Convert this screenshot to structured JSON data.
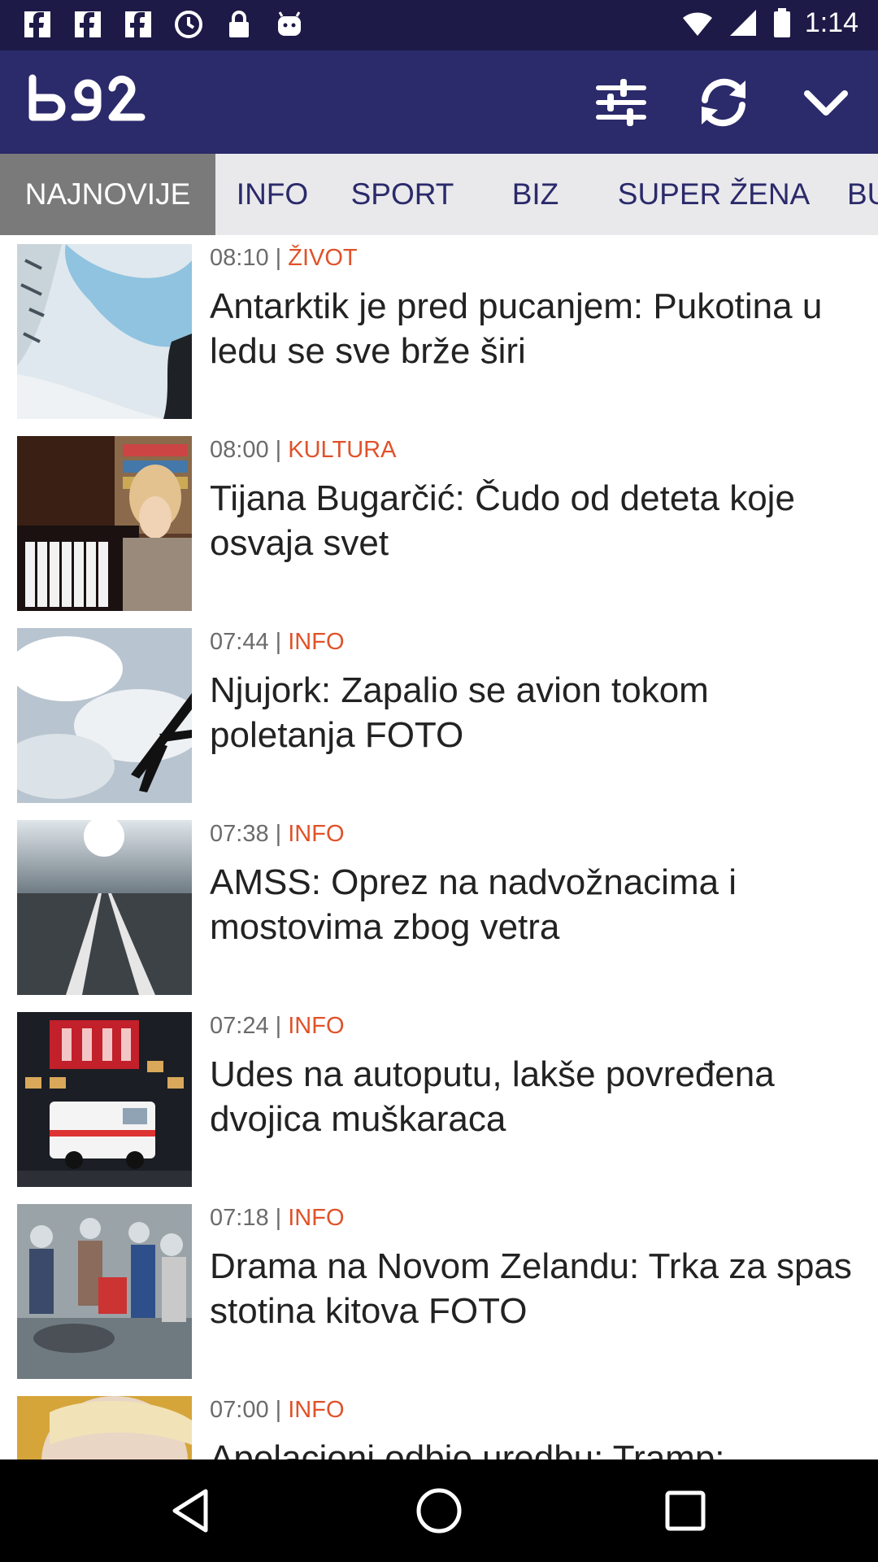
{
  "status_bar": {
    "time": "1:14",
    "icons": [
      "facebook-icon",
      "facebook-icon",
      "facebook-icon",
      "sync-icon",
      "lock-icon",
      "android-icon",
      "wifi-icon",
      "signal-icon",
      "battery-icon"
    ]
  },
  "header": {
    "logo": "b92",
    "buttons": [
      "filter-sliders-icon",
      "refresh-icon",
      "chevron-down-icon"
    ]
  },
  "tabs": [
    {
      "label": "NAJNOVIJE",
      "active": true
    },
    {
      "label": "INFO"
    },
    {
      "label": "SPORT"
    },
    {
      "label": "BIZ"
    },
    {
      "label": "SUPER ŽENA"
    },
    {
      "label": "BU"
    }
  ],
  "news": [
    {
      "time": "08:10",
      "separator": " | ",
      "category": "ŽIVOT",
      "title": "Antarktik je pred pucanjem: Pukotina u ledu se sve brže širi"
    },
    {
      "time": "08:00",
      "separator": " | ",
      "category": "KULTURA",
      "title": "Tijana Bugarčić: Čudo od deteta koje osvaja svet"
    },
    {
      "time": "07:44",
      "separator": " | ",
      "category": "INFO",
      "title": "Njujork: Zapalio se avion tokom poletanja FOTO"
    },
    {
      "time": "07:38",
      "separator": " | ",
      "category": "INFO",
      "title": "AMSS: Oprez na nadvožnacima i mostovima zbog vetra"
    },
    {
      "time": "07:24",
      "separator": " | ",
      "category": "INFO",
      "title": "Udes na autoputu, lakše povređena dvojica muškaraca"
    },
    {
      "time": "07:18",
      "separator": " | ",
      "category": "INFO",
      "title": "Drama na Novom Zelandu: Trka za spas stotina kitova FOTO"
    },
    {
      "time": "07:00",
      "separator": " | ",
      "category": "INFO",
      "title": "Apelacioni odbio uredbu: Tramp:"
    }
  ],
  "colors": {
    "status_bar": "#1d1a47",
    "header": "#2b2a6b",
    "tab_bg": "#e9e9ec",
    "tab_active": "#7a7a7a",
    "category": "#e0522a"
  },
  "nav": [
    "back-icon",
    "home-icon",
    "recents-icon"
  ]
}
